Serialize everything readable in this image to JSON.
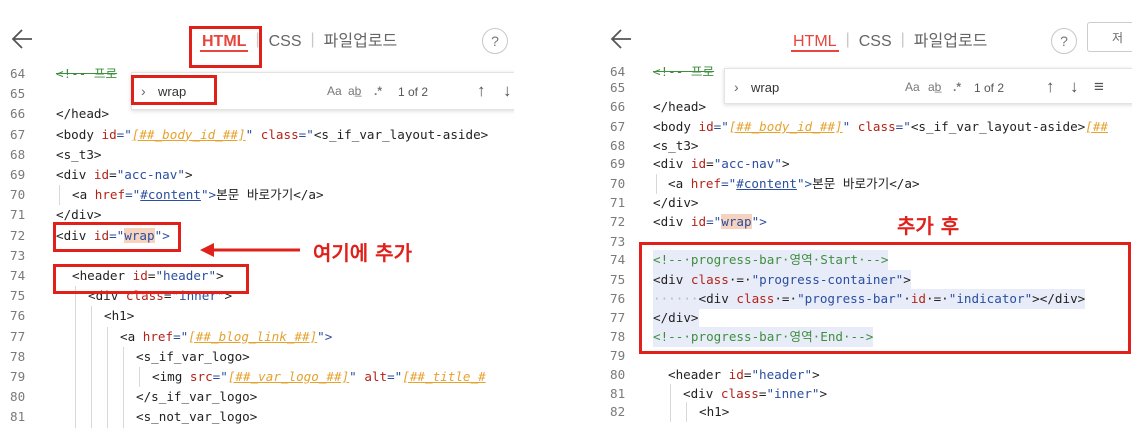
{
  "left": {
    "tabs": {
      "html": "HTML",
      "css": "CSS",
      "upload": "파일업로드",
      "sep": "|"
    },
    "help": "?",
    "find": {
      "chevron": "›",
      "query": "wrap",
      "match_case": "Aa",
      "whole_word": "ab̲",
      "regex": ".*",
      "count": "1 of 2",
      "up": "↑",
      "down": "↓"
    },
    "annotation": "여기에 추가",
    "lines": {
      "l64": {
        "n": "64",
        "t": "<!-- 프로"
      },
      "l65": {
        "n": "65"
      },
      "l66": {
        "n": "66",
        "t": "</head>"
      },
      "l67": {
        "n": "67",
        "a": "<body ",
        "b": "id",
        "c": "=\"",
        "d": "[##_body_id_##]",
        "e": "\" ",
        "f": "class",
        "g": "=\"",
        "h": "<s_if_var_layout-aside>"
      },
      "l68": {
        "n": "68",
        "t": "<s_t3>"
      },
      "l69": {
        "n": "69",
        "a": "<div ",
        "b": "id",
        "c": "=",
        "d": "\"acc-nav\"",
        "e": ">"
      },
      "l70": {
        "n": "70",
        "a": "<a ",
        "b": "href",
        "c": "=\"",
        "d": "#content",
        "e": "\">",
        "f": "본문 바로가기",
        "g": "</a>"
      },
      "l71": {
        "n": "71",
        "t": "</div>"
      },
      "l72": {
        "n": "72",
        "a": "<div ",
        "b": "id",
        "c": "=\"",
        "d": "wrap",
        "e": "\">"
      },
      "l73": {
        "n": "73"
      },
      "l74": {
        "n": "74",
        "a": "<header ",
        "b": "id",
        "c": "=",
        "d": "\"header\"",
        "e": ">"
      },
      "l75": {
        "n": "75",
        "a": "<div ",
        "b": "class",
        "c": "=",
        "d": "\"inner\"",
        "e": ">"
      },
      "l76": {
        "n": "76",
        "t": "<h1>"
      },
      "l77": {
        "n": "77",
        "a": "<a ",
        "b": "href",
        "c": "=\"",
        "d": "[##_blog_link_##]",
        "e": "\">"
      },
      "l78": {
        "n": "78",
        "t": "<s_if_var_logo>"
      },
      "l79": {
        "n": "79",
        "a": "<img ",
        "b": "src",
        "c": "=\"",
        "d": "[##_var_logo_##]",
        "e": "\" ",
        "f": "alt",
        "g": "=\"",
        "h": "[##_title_#"
      },
      "l80": {
        "n": "80",
        "t": "</s_if_var_logo>"
      },
      "l81": {
        "n": "81",
        "t": "<s_not_var_logo>"
      }
    }
  },
  "right": {
    "tabs": {
      "html": "HTML",
      "css": "CSS",
      "upload": "파일업로드",
      "sep": "|"
    },
    "help": "?",
    "extra_btn": "저",
    "find": {
      "chevron": "›",
      "query": "wrap",
      "match_case": "Aa",
      "whole_word": "ab̲",
      "regex": ".*",
      "count": "1 of 2",
      "up": "↑",
      "down": "↓",
      "menu": "≡"
    },
    "annotation": "추가 후",
    "lines": {
      "l64": {
        "n": "64",
        "t": "<!-- 프로"
      },
      "l65": {
        "n": "65"
      },
      "l66": {
        "n": "66",
        "t": "</head>"
      },
      "l67": {
        "n": "67",
        "a": "<body ",
        "b": "id",
        "c": "=\"",
        "d": "[##_body_id_##]",
        "e": "\" ",
        "f": "class",
        "g": "=\"",
        "h": "<s_if_var_layout-aside>",
        "i": "[##"
      },
      "l68": {
        "n": "68",
        "t": "<s_t3>"
      },
      "l69": {
        "n": "69",
        "a": "<div ",
        "b": "id",
        "c": "=",
        "d": "\"acc-nav\"",
        "e": ">"
      },
      "l70": {
        "n": "70",
        "a": "<a ",
        "b": "href",
        "c": "=\"",
        "d": "#content",
        "e": "\">",
        "f": "본문 바로가기",
        "g": "</a>"
      },
      "l71": {
        "n": "71",
        "t": "</div>"
      },
      "l72": {
        "n": "72",
        "a": "<div ",
        "b": "id",
        "c": "=\"",
        "d": "wrap",
        "e": "\">"
      },
      "l73": {
        "n": "73"
      },
      "l74": {
        "n": "74",
        "t": "<!--·progress-bar·영역·Start·-->"
      },
      "l75": {
        "n": "75",
        "a": "<div ",
        "b": "class",
        "c": "·=·",
        "d": "\"progress-container\"",
        "e": ">"
      },
      "l76": {
        "n": "76",
        "dots": "······",
        "a": "<div ",
        "b": "class",
        "c": "·=·",
        "d": "\"progress-bar\"",
        "e": "·",
        "f": "id",
        "g": "·=·",
        "h": "\"indicator\"",
        "i": "></div>"
      },
      "l77": {
        "n": "77",
        "t": "</div>"
      },
      "l78": {
        "n": "78",
        "t": "<!--·progress-bar·영역·End·-->"
      },
      "l79": {
        "n": "79"
      },
      "l80": {
        "n": "80",
        "a": "<header ",
        "b": "id",
        "c": "=",
        "d": "\"header\"",
        "e": ">"
      },
      "l81": {
        "n": "81",
        "a": "<div ",
        "b": "class",
        "c": "=",
        "d": "\"inner\"",
        "e": ">"
      },
      "l82": {
        "n": "82",
        "t": "<h1>"
      }
    }
  }
}
